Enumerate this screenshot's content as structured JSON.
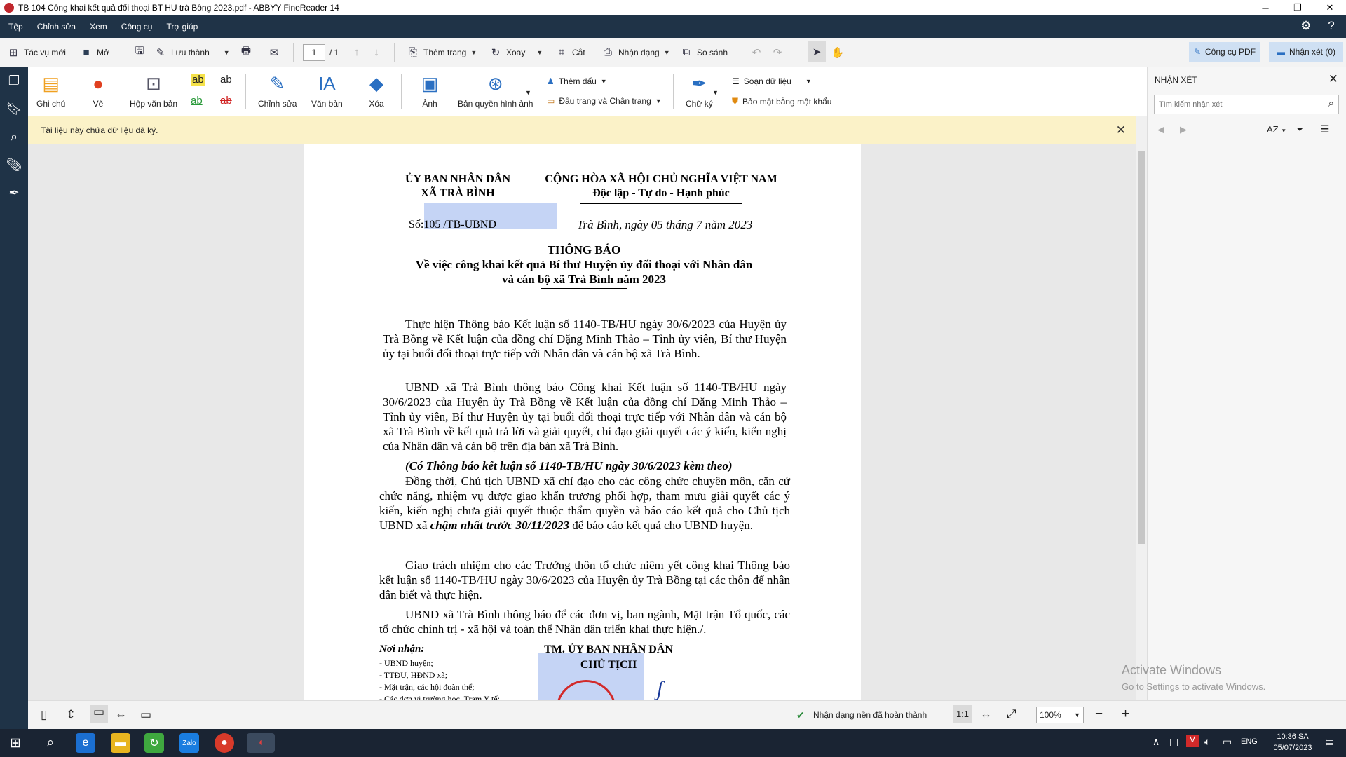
{
  "window": {
    "title": "TB 104 Công khai kết quả đối thoại BT HU trà Bồng 2023.pdf - ABBYY FineReader 14",
    "buttons": {
      "minimize": "─",
      "restore": "❐",
      "close": "✕"
    }
  },
  "menu": {
    "items": [
      "Tệp",
      "Chỉnh sửa",
      "Xem",
      "Công cụ",
      "Trợ giúp"
    ]
  },
  "toolbar": {
    "new_task": "Tác vụ mới",
    "open": "Mở",
    "save_as": "Lưu thành",
    "page_current": "1",
    "page_total": "/ 1",
    "add_page": "Thêm trang",
    "rotate": "Xoay",
    "crop": "Cắt",
    "recognize": "Nhận dạng",
    "compare": "So sánh",
    "pdf_tools": "Công cụ PDF",
    "comments": "Nhận xét (0)"
  },
  "ribbon": {
    "note": "Ghi chú",
    "draw": "Vẽ",
    "textbox": "Hộp văn bản",
    "edit": "Chỉnh sửa",
    "text": "Văn bản",
    "erase": "Xóa",
    "image": "Ảnh",
    "image_copyright": "Bản quyền hình ảnh",
    "add_header": "Thêm dấu",
    "header_footer": "Đầu trang và Chân trang",
    "signature": "Chữ ký",
    "edit_data": "Soạn dữ liệu",
    "password_protect": "Bảo mật bằng mật khẩu",
    "hl_ab": "ab"
  },
  "notice": {
    "text": "Tài liệu này chứa dữ liệu đã ký."
  },
  "document": {
    "org_line1": "ỦY BAN NHÂN DÂN",
    "org_line2": "XÃ TRÀ BÌNH",
    "nation_line1": "CỘNG HÒA XÃ HỘI CHỦ NGHĨA VIỆT NAM",
    "nation_line2": "Độc lập - Tự do - Hạnh phúc",
    "number": "Số:105 /TB-UBND",
    "date": "Trà Bình, ngày 05  tháng 7 năm 2023",
    "title": "THÔNG BÁO",
    "subtitle1": "Về việc công khai kết quả Bí thư Huyện ủy đối thoại với Nhân dân",
    "subtitle2": "và cán bộ xã Trà Bình năm 2023",
    "p1": "Thực hiện Thông báo Kết luận số 1140-TB/HU ngày 30/6/2023 của Huyện ủy Trà Bồng về Kết luận của đồng chí Đặng Minh Thảo – Tỉnh ủy viên, Bí thư Huyện ủy tại buổi đối  thoại trực tiếp với Nhân dân và cán bộ xã Trà Bình.",
    "p2": "UBND xã Trà Bình thông báo Công khai Kết luận số 1140-TB/HU ngày 30/6/2023 của Huyện ủy Trà Bồng về Kết luận của đồng chí Đặng Minh Thảo – Tỉnh ủy viên, Bí thư Huyện ủy tại buổi đối  thoại trực tiếp với Nhân dân và cán bộ xã Trà Bình về kết quả trả lời và giải quyết, chỉ đạo giải quyết các ý kiến, kiến nghị của Nhân dân và cán bộ trên địa bàn xã Trà Bình.",
    "p3": "(Có Thông báo kết luận số 1140-TB/HU ngày 30/6/2023 kèm theo)",
    "p4a": "Đồng thời, Chủ tịch UBND xã chỉ đạo cho các công chức chuyên môn, căn cứ chức năng, nhiệm vụ được giao khẩn trương phối hợp, tham mưu giải quyết các ý kiến, kiến nghị chưa giải quyết thuộc thẩm quyền và báo cáo kết quả cho Chủ tịch UBND xã ",
    "p4b": "chậm nhất trước 30/11/2023",
    "p4c": " để báo cáo kết quả cho UBND huyện.",
    "p5": "Giao trách nhiệm cho các Trưởng thôn tổ chức niêm yết công khai Thông báo kết luận số 1140-TB/HU ngày 30/6/2023 của Huyện ủy Trà Bồng tại các thôn để nhân dân biết và thực hiện.",
    "p6": "UBND xã Trà Bình thông báo để các đơn vị, ban ngành, Mặt trận Tổ quốc, các tổ chức chính trị - xã hội và toàn thể Nhân dân triển khai thực hiện./.",
    "recipients_label": "Nơi nhận:",
    "recipients": [
      "- UBND huyện;",
      "- TTĐU, HĐND xã;",
      "- Mặt trận, các hội đoàn thể;",
      "- Các đơn vị trường học, Trạm Y tế;"
    ],
    "sign_org": "TM. ỦY BAN NHÂN DÂN",
    "sign_title": "CHỦ TỊCH"
  },
  "right_panel": {
    "title": "NHẬN XÉT",
    "search_placeholder": "Tìm kiếm nhận xét",
    "sort_label": "AZ"
  },
  "statusbar": {
    "recognition_status": "Nhận dạng nền đã hoàn thành",
    "zoom": "100%",
    "actual_size": "1:1"
  },
  "watermark": {
    "line1": "Activate Windows",
    "line2": "Go to Settings to activate Windows."
  },
  "taskbar": {
    "lang": "ENG",
    "time": "10:36 SA",
    "date": "05/07/2023"
  },
  "colors": {
    "navy": "#1f3347",
    "notice_bg": "#fbf2c8",
    "highlight": "#c5d4f5",
    "accent_blue": "#cfe0f3"
  }
}
